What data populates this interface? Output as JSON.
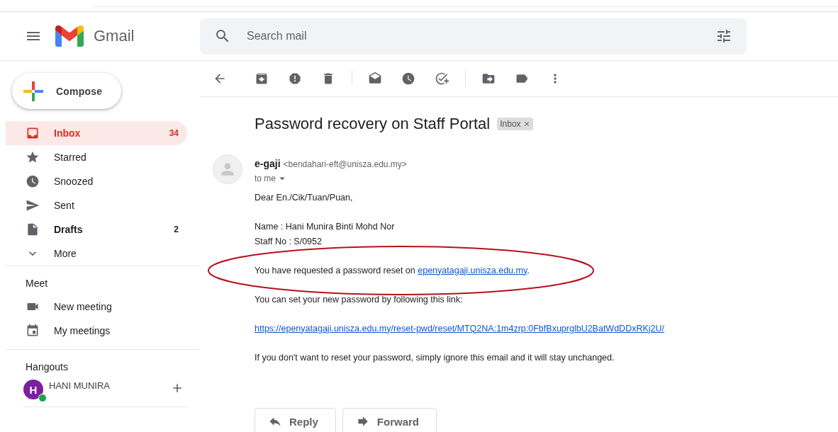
{
  "header": {
    "logo_text": "Gmail",
    "search": {
      "placeholder": "Search mail"
    }
  },
  "compose": "Compose",
  "nav": [
    {
      "label": "Inbox",
      "count": "34",
      "selected": true,
      "unread": true
    },
    {
      "label": "Starred",
      "selected": false,
      "unread": false
    },
    {
      "label": "Snoozed",
      "selected": false,
      "unread": false
    },
    {
      "label": "Sent",
      "selected": false,
      "unread": false
    },
    {
      "label": "Drafts",
      "count": "2",
      "selected": false,
      "unread": true
    },
    {
      "label": "More",
      "selected": false,
      "unread": false
    }
  ],
  "meet": {
    "title": "Meet",
    "items": [
      "New meeting",
      "My meetings"
    ]
  },
  "hangouts": {
    "title": "Hangouts",
    "users": [
      {
        "initial": "H",
        "name": "HANI MUNIRA",
        "online": true
      }
    ]
  },
  "message": {
    "subject": "Password recovery on Staff Portal",
    "labels": [
      {
        "text": "Inbox",
        "removable": true
      }
    ],
    "sender": {
      "name": "e-gaji",
      "email": "<bendahari-eft@unisza.edu.my>"
    },
    "recipient": "to me",
    "body": [
      {
        "kind": "text",
        "lines": [
          "Dear En./Cik/Tuan/Puan,"
        ]
      },
      {
        "kind": "text",
        "lines": [
          "Name : Hani Munira Binti Mohd Nor",
          "Staff No : S/0952"
        ]
      },
      {
        "kind": "sentence",
        "before": "You have requested a password reset on ",
        "link": "epenyatagaji.unisza.edu.my",
        "after": ".",
        "circled": true
      },
      {
        "kind": "text",
        "lines": [
          "You can set your new password by following this link:"
        ]
      },
      {
        "kind": "link",
        "text": "https://epenyatagaji.unisza.edu.my/reset-pwd/reset/MTQ2NA:1m4zrp:0FbfBxuprglbU2BatWdDDxRKj2U/"
      },
      {
        "kind": "text",
        "lines": [
          "If you don't want to reset your password, simply ignore this email and it will stay unchanged."
        ]
      }
    ],
    "actions": [
      "Reply",
      "Forward"
    ]
  }
}
